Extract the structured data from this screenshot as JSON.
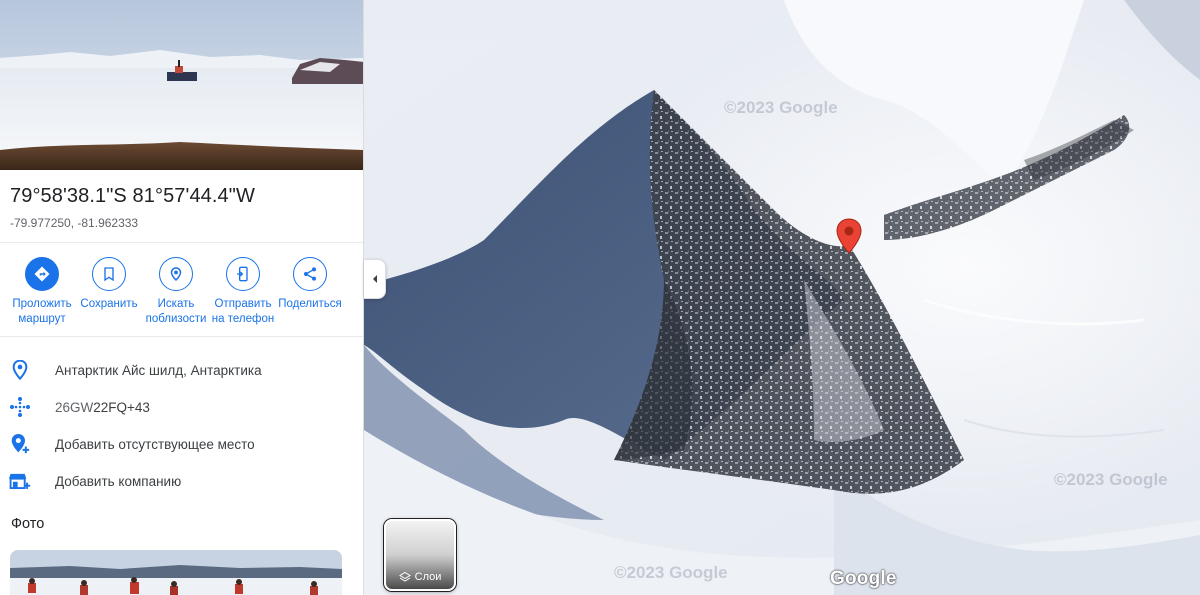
{
  "place": {
    "coords_dms": "79°58'38.1\"S 81°57'44.4\"W",
    "coords_decimal": "-79.977250, -81.962333"
  },
  "actions": [
    {
      "label_line1": "Проложить",
      "label_line2": "маршрут",
      "icon": "directions-icon"
    },
    {
      "label_line1": "Сохранить",
      "label_line2": "",
      "icon": "bookmark-icon"
    },
    {
      "label_line1": "Искать",
      "label_line2": "поблизости",
      "icon": "nearby-icon"
    },
    {
      "label_line1": "Отправить",
      "label_line2": "на телефон",
      "icon": "send-to-phone-icon"
    },
    {
      "label_line1": "Поделиться",
      "label_line2": "",
      "icon": "share-icon"
    }
  ],
  "info": {
    "address": "Антарктик Айс шилд, Антарктика",
    "plus_code_prefix": "26GW",
    "plus_code_rest": "22FQ+43",
    "add_missing_place": "Добавить отсутствующее место",
    "add_business": "Добавить компанию"
  },
  "photos": {
    "heading": "Фото"
  },
  "map": {
    "layers_label": "Слои",
    "logo": "Google",
    "watermark": "©2023 Google"
  },
  "colors": {
    "accent": "#1a73e8",
    "pin": "#ea4335"
  }
}
